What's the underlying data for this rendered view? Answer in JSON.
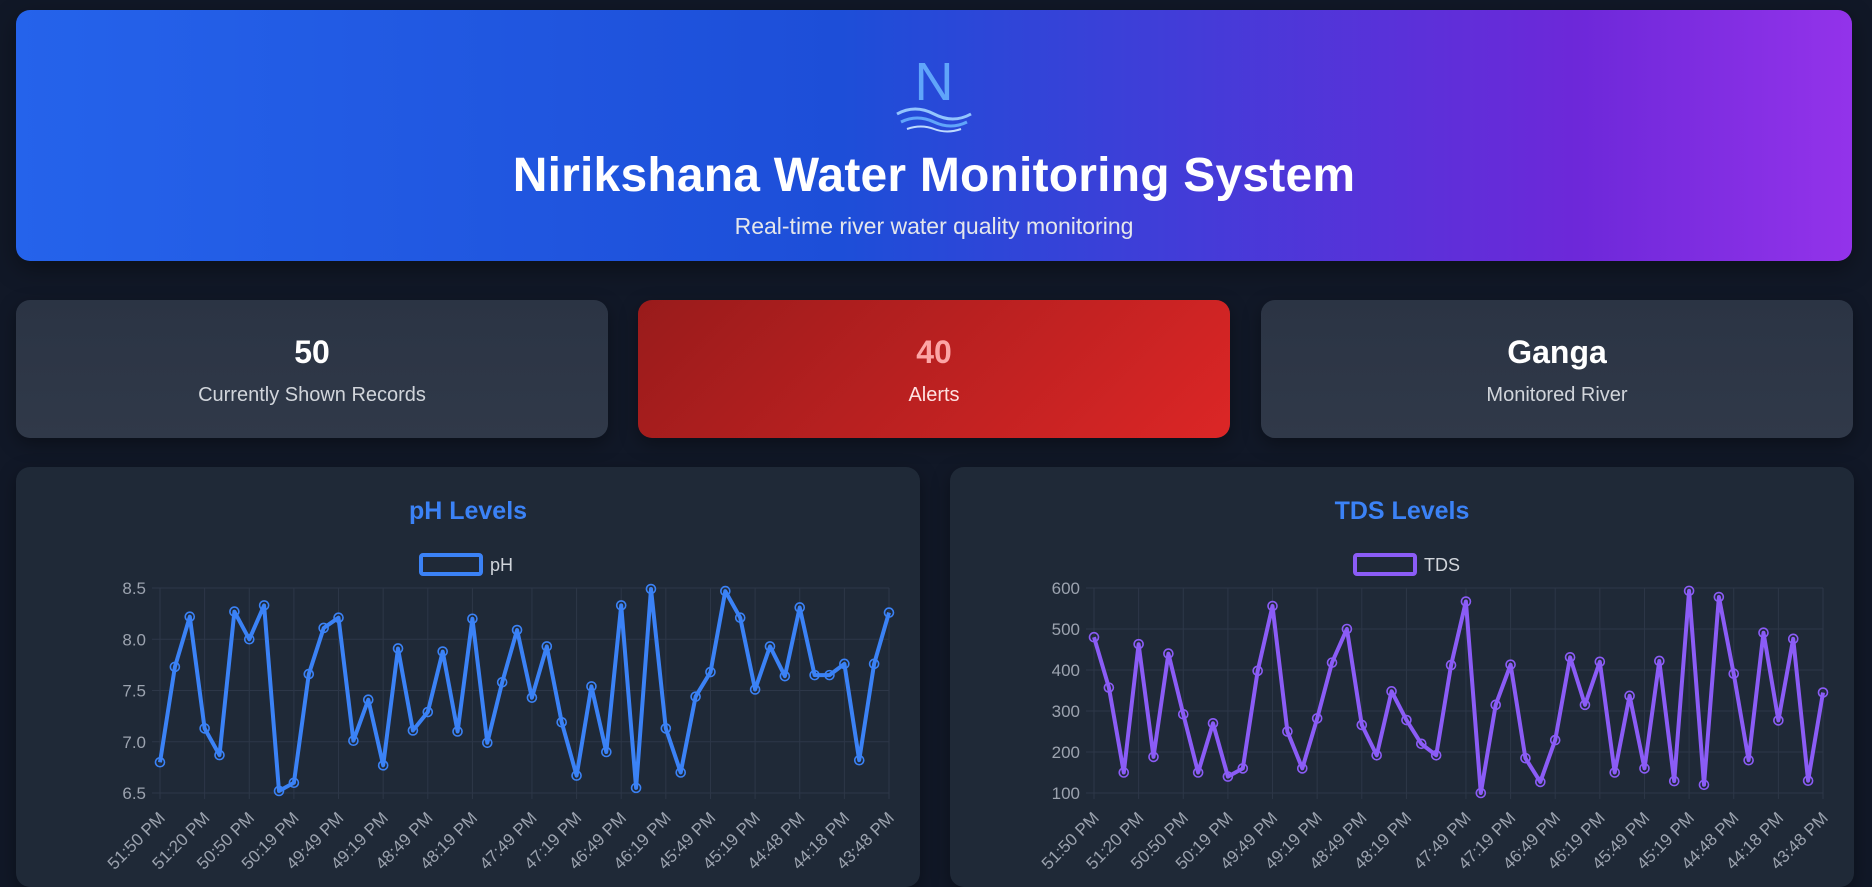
{
  "header": {
    "title": "Nirikshana Water Monitoring System",
    "subtitle": "Real-time river water quality monitoring",
    "logo_letter": "N"
  },
  "stats": [
    {
      "value": "50",
      "label": "Currently Shown Records"
    },
    {
      "value": "40",
      "label": "Alerts"
    },
    {
      "value": "Ganga",
      "label": "Monitored River"
    }
  ],
  "colors": {
    "ph": "#3b82f6",
    "tds": "#8b5cf6",
    "accent": "#3b82f6"
  },
  "chart_data": [
    {
      "type": "line",
      "title": "pH Levels",
      "series": [
        {
          "name": "pH",
          "values": [
            6.8,
            7.73,
            8.22,
            7.13,
            6.87,
            8.27,
            8.0,
            8.33,
            6.52,
            6.6,
            7.66,
            8.11,
            8.21,
            7.01,
            7.41,
            6.77,
            7.91,
            7.11,
            7.29,
            7.88,
            7.1,
            8.2,
            6.99,
            7.58,
            8.09,
            7.43,
            7.93,
            7.19,
            6.67,
            7.54,
            6.9,
            8.33,
            6.55,
            8.49,
            7.13,
            6.7,
            7.44,
            7.68,
            8.47,
            8.21,
            7.51,
            7.93,
            7.64,
            8.31,
            7.65,
            7.65,
            7.76,
            6.82,
            7.76,
            8.26
          ]
        }
      ],
      "x_tick_labels": [
        "51:50 PM",
        "51:20 PM",
        "50:50 PM",
        "50:19 PM",
        "49:49 PM",
        "49:19 PM",
        "48:49 PM",
        "48:19 PM",
        "47:49 PM",
        "47:19 PM",
        "46:49 PM",
        "46:19 PM",
        "45:49 PM",
        "45:19 PM",
        "44:48 PM",
        "44:18 PM",
        "43:48 PM"
      ],
      "y_ticks": [
        "6.5",
        "7.0",
        "7.5",
        "8.0",
        "8.5"
      ],
      "ylim": [
        6.5,
        8.5
      ],
      "legend": "top"
    },
    {
      "type": "line",
      "title": "TDS Levels",
      "series": [
        {
          "name": "TDS",
          "values": [
            480,
            357,
            150,
            463,
            188,
            440,
            292,
            150,
            270,
            140,
            160,
            398,
            556,
            250,
            160,
            282,
            418,
            500,
            266,
            192,
            348,
            278,
            220,
            192,
            412,
            567,
            100,
            315,
            413,
            185,
            127,
            229,
            431,
            315,
            420,
            150,
            337,
            160,
            422,
            129,
            593,
            120,
            578,
            391,
            180,
            491,
            277,
            476,
            130,
            345
          ]
        }
      ],
      "x_tick_labels": [
        "51:50 PM",
        "51:20 PM",
        "50:50 PM",
        "50:19 PM",
        "49:49 PM",
        "49:19 PM",
        "48:49 PM",
        "48:19 PM",
        "47:49 PM",
        "47:19 PM",
        "46:49 PM",
        "46:19 PM",
        "45:49 PM",
        "45:19 PM",
        "44:48 PM",
        "44:18 PM",
        "43:48 PM"
      ],
      "y_ticks": [
        "100",
        "200",
        "300",
        "400",
        "500",
        "600"
      ],
      "ylim": [
        100,
        600
      ],
      "legend": "top"
    }
  ]
}
